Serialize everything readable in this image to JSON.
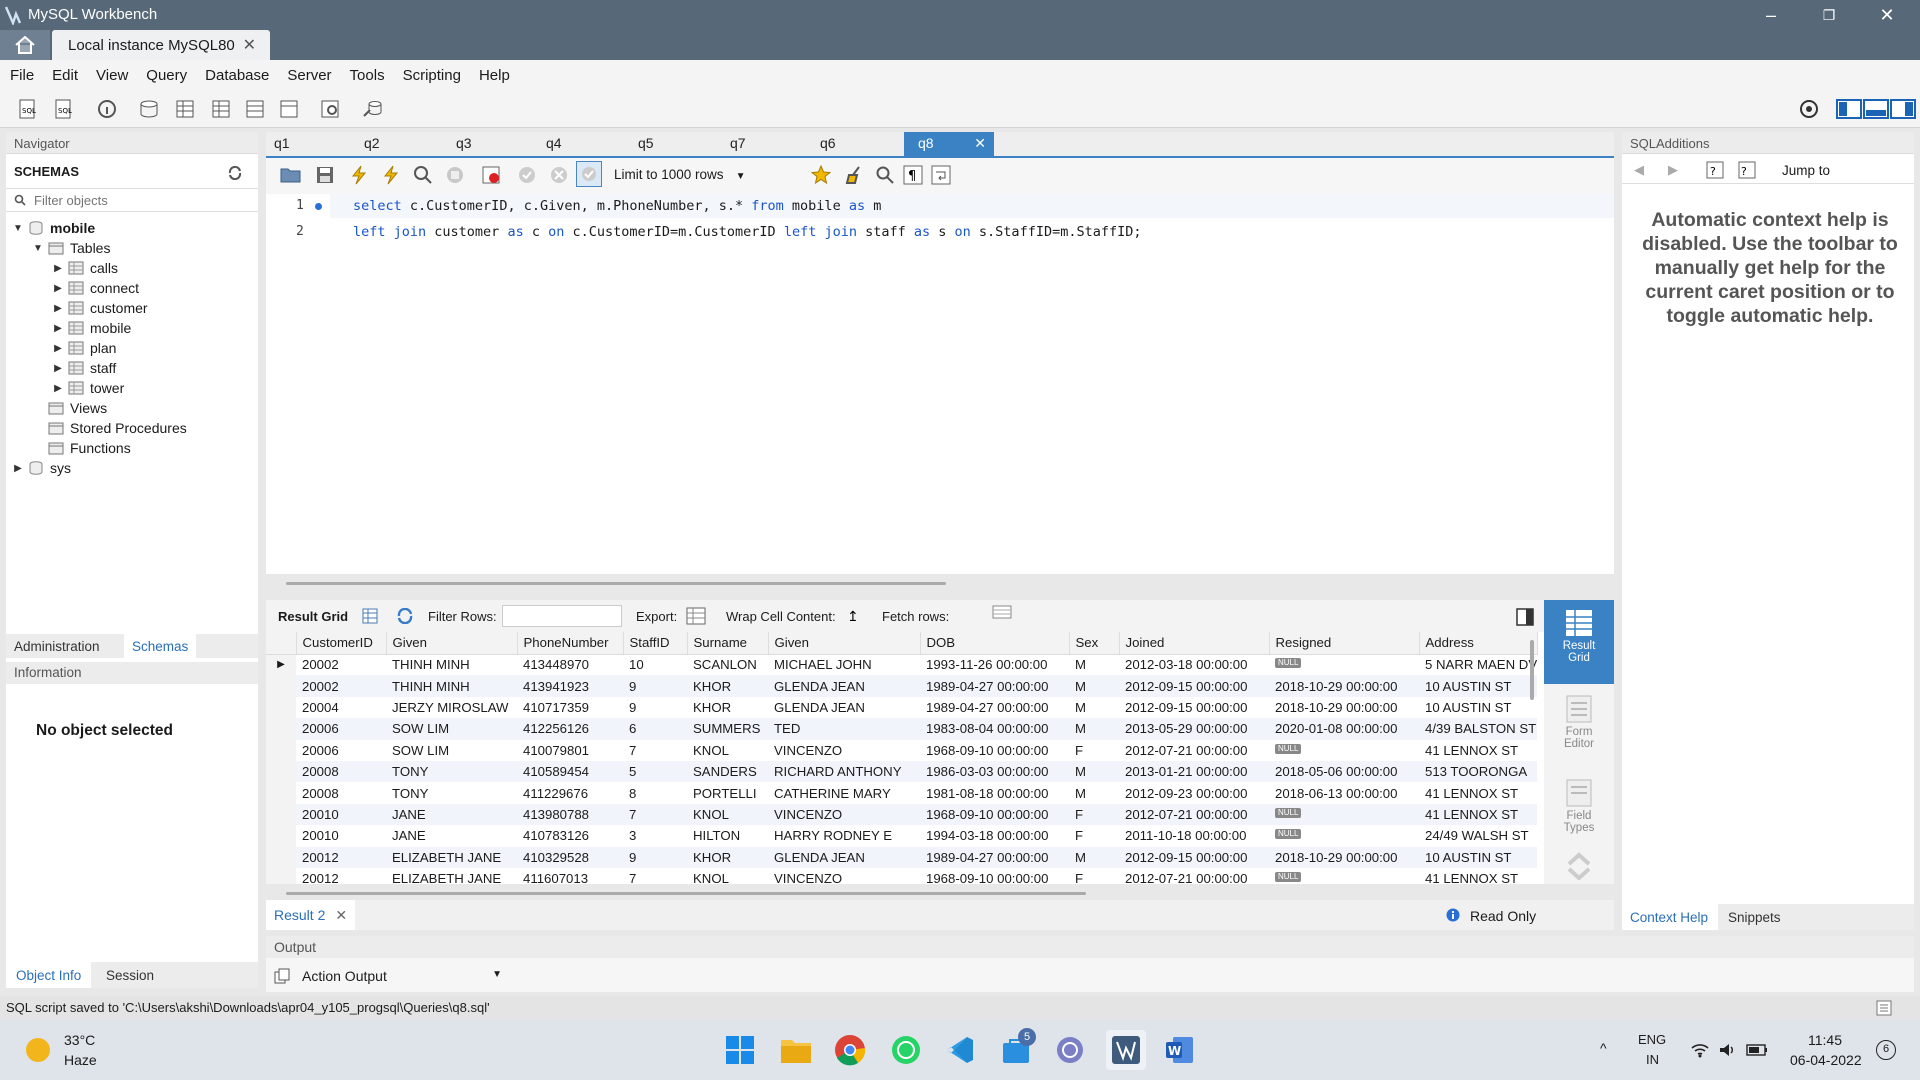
{
  "window": {
    "title": "MySQL Workbench",
    "connection_tab": "Local instance MySQL80"
  },
  "menu": [
    "File",
    "Edit",
    "View",
    "Query",
    "Database",
    "Server",
    "Tools",
    "Scripting",
    "Help"
  ],
  "navigator": {
    "header": "Navigator",
    "schemas_label": "SCHEMAS",
    "filter_placeholder": "Filter objects",
    "schema": "mobile",
    "tables_label": "Tables",
    "tables": [
      "calls",
      "connect",
      "customer",
      "mobile",
      "plan",
      "staff",
      "tower"
    ],
    "views": "Views",
    "procedures": "Stored Procedures",
    "functions": "Functions",
    "sys": "sys",
    "tab_admin": "Administration",
    "tab_schemas": "Schemas",
    "info_header": "Information",
    "no_object": "No object selected",
    "tab_objinfo": "Object Info",
    "tab_session": "Session"
  },
  "query_tabs": [
    "q1",
    "q2",
    "q3",
    "q4",
    "q5",
    "q7",
    "q6",
    "q8"
  ],
  "editor": {
    "limit": "Limit to 1000 rows",
    "line_numbers": [
      "1",
      "2"
    ],
    "line1": {
      "kw1": "select",
      "t1": " c.CustomerID, c.Given, m.PhoneNumber, s.*",
      "kw2": " from",
      "t2": " mobile",
      "kw3": " as",
      "t3": " m"
    },
    "line2": {
      "kw1": "left join",
      "t1": " customer",
      "kw2": " as",
      "t2": " c",
      "kw3": " on",
      "t3": " c.CustomerID=m.CustomerID ",
      "kw4": "left join",
      "t4": " staff ",
      "kw5": "as",
      "t5": " s ",
      "kw6": "on",
      "t6": " s.StaffID=m.StaffID;"
    }
  },
  "result_toolbar": {
    "grid": "Result Grid",
    "filter": "Filter Rows:",
    "export": "Export:",
    "wrap": "Wrap Cell Content:",
    "fetch": "Fetch rows:"
  },
  "result": {
    "columns": [
      "CustomerID",
      "Given",
      "PhoneNumber",
      "StaffID",
      "Surname",
      "Given",
      "DOB",
      "Sex",
      "Joined",
      "Resigned",
      "Address"
    ],
    "rows": [
      [
        "20002",
        "THINH MINH",
        "413448970",
        "10",
        "SCANLON",
        "MICHAEL JOHN",
        "1993-11-26 00:00:00",
        "M",
        "2012-03-18 00:00:00",
        "NULL",
        "5 NARR MAEN DV"
      ],
      [
        "20002",
        "THINH MINH",
        "413941923",
        "9",
        "KHOR",
        "GLENDA JEAN",
        "1989-04-27 00:00:00",
        "M",
        "2012-09-15 00:00:00",
        "2018-10-29 00:00:00",
        "10 AUSTIN ST"
      ],
      [
        "20004",
        "JERZY MIROSLAW",
        "410717359",
        "9",
        "KHOR",
        "GLENDA JEAN",
        "1989-04-27 00:00:00",
        "M",
        "2012-09-15 00:00:00",
        "2018-10-29 00:00:00",
        "10 AUSTIN ST"
      ],
      [
        "20006",
        "SOW LIM",
        "412256126",
        "6",
        "SUMMERS",
        "TED",
        "1983-08-04 00:00:00",
        "M",
        "2013-05-29 00:00:00",
        "2020-01-08 00:00:00",
        "4/39 BALSTON ST"
      ],
      [
        "20006",
        "SOW LIM",
        "410079801",
        "7",
        "KNOL",
        "VINCENZO",
        "1968-09-10 00:00:00",
        "F",
        "2012-07-21 00:00:00",
        "NULL",
        "41 LENNOX ST"
      ],
      [
        "20008",
        "TONY",
        "410589454",
        "5",
        "SANDERS",
        "RICHARD ANTHONY",
        "1986-03-03 00:00:00",
        "M",
        "2013-01-21 00:00:00",
        "2018-05-06 00:00:00",
        "513 TOORONGA"
      ],
      [
        "20008",
        "TONY",
        "411229676",
        "8",
        "PORTELLI",
        "CATHERINE MARY",
        "1981-08-18 00:00:00",
        "M",
        "2012-09-23 00:00:00",
        "2018-06-13 00:00:00",
        "41 LENNOX ST"
      ],
      [
        "20010",
        "JANE",
        "413980788",
        "7",
        "KNOL",
        "VINCENZO",
        "1968-09-10 00:00:00",
        "F",
        "2012-07-21 00:00:00",
        "NULL",
        "41 LENNOX ST"
      ],
      [
        "20010",
        "JANE",
        "410783126",
        "3",
        "HILTON",
        "HARRY RODNEY E",
        "1994-03-18 00:00:00",
        "F",
        "2011-10-18 00:00:00",
        "NULL",
        "24/49 WALSH ST"
      ],
      [
        "20012",
        "ELIZABETH JANE",
        "410329528",
        "9",
        "KHOR",
        "GLENDA JEAN",
        "1989-04-27 00:00:00",
        "M",
        "2012-09-15 00:00:00",
        "2018-10-29 00:00:00",
        "10 AUSTIN ST"
      ],
      [
        "20012",
        "ELIZABETH JANE",
        "411607013",
        "7",
        "KNOL",
        "VINCENZO",
        "1968-09-10 00:00:00",
        "F",
        "2012-07-21 00:00:00",
        "NULL",
        "41 LENNOX ST"
      ]
    ]
  },
  "result_side": {
    "grid": "Result Grid",
    "form": "Form Editor",
    "field": "Field Types"
  },
  "result_tab": "Result 2",
  "read_only": "Read Only",
  "output": {
    "header": "Output",
    "select": "Action Output"
  },
  "sql_additions": {
    "header": "SQLAdditions",
    "jump": "Jump to",
    "help": "Automatic context help is disabled. Use the toolbar to manually get help for the current caret position or to toggle automatic help.",
    "tab_context": "Context Help",
    "tab_snippets": "Snippets"
  },
  "status": "SQL script saved to 'C:\\Users\\akshi\\Downloads\\apr04_y105_progsql\\Queries\\q8.sql'",
  "taskbar": {
    "temp": "33°C",
    "weather": "Haze",
    "lang1": "ENG",
    "lang2": "IN",
    "time": "11:45",
    "date": "06-04-2022",
    "badge": "5",
    "notif": "6"
  },
  "colors": {
    "accent": "#3a82c4",
    "titlebar": "#576878",
    "keyword": "#1a55c9"
  }
}
